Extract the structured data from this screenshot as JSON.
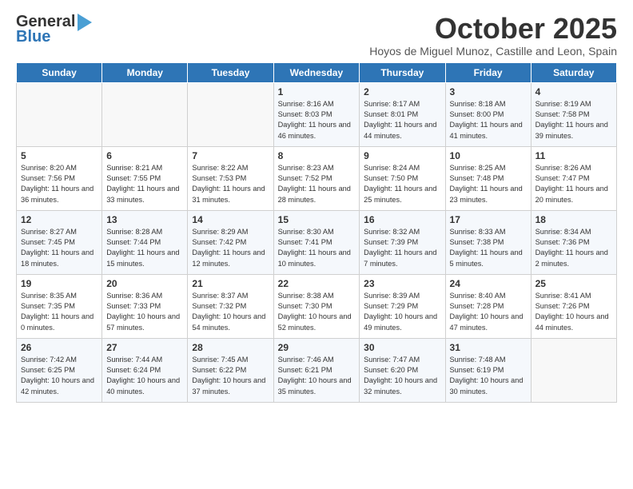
{
  "header": {
    "logo_general": "General",
    "logo_blue": "Blue",
    "month_title": "October 2025",
    "subtitle": "Hoyos de Miguel Munoz, Castille and Leon, Spain"
  },
  "weekdays": [
    "Sunday",
    "Monday",
    "Tuesday",
    "Wednesday",
    "Thursday",
    "Friday",
    "Saturday"
  ],
  "weeks": [
    [
      {
        "day": "",
        "sunrise": "",
        "sunset": "",
        "daylight": ""
      },
      {
        "day": "",
        "sunrise": "",
        "sunset": "",
        "daylight": ""
      },
      {
        "day": "",
        "sunrise": "",
        "sunset": "",
        "daylight": ""
      },
      {
        "day": "1",
        "sunrise": "Sunrise: 8:16 AM",
        "sunset": "Sunset: 8:03 PM",
        "daylight": "Daylight: 11 hours and 46 minutes."
      },
      {
        "day": "2",
        "sunrise": "Sunrise: 8:17 AM",
        "sunset": "Sunset: 8:01 PM",
        "daylight": "Daylight: 11 hours and 44 minutes."
      },
      {
        "day": "3",
        "sunrise": "Sunrise: 8:18 AM",
        "sunset": "Sunset: 8:00 PM",
        "daylight": "Daylight: 11 hours and 41 minutes."
      },
      {
        "day": "4",
        "sunrise": "Sunrise: 8:19 AM",
        "sunset": "Sunset: 7:58 PM",
        "daylight": "Daylight: 11 hours and 39 minutes."
      }
    ],
    [
      {
        "day": "5",
        "sunrise": "Sunrise: 8:20 AM",
        "sunset": "Sunset: 7:56 PM",
        "daylight": "Daylight: 11 hours and 36 minutes."
      },
      {
        "day": "6",
        "sunrise": "Sunrise: 8:21 AM",
        "sunset": "Sunset: 7:55 PM",
        "daylight": "Daylight: 11 hours and 33 minutes."
      },
      {
        "day": "7",
        "sunrise": "Sunrise: 8:22 AM",
        "sunset": "Sunset: 7:53 PM",
        "daylight": "Daylight: 11 hours and 31 minutes."
      },
      {
        "day": "8",
        "sunrise": "Sunrise: 8:23 AM",
        "sunset": "Sunset: 7:52 PM",
        "daylight": "Daylight: 11 hours and 28 minutes."
      },
      {
        "day": "9",
        "sunrise": "Sunrise: 8:24 AM",
        "sunset": "Sunset: 7:50 PM",
        "daylight": "Daylight: 11 hours and 25 minutes."
      },
      {
        "day": "10",
        "sunrise": "Sunrise: 8:25 AM",
        "sunset": "Sunset: 7:48 PM",
        "daylight": "Daylight: 11 hours and 23 minutes."
      },
      {
        "day": "11",
        "sunrise": "Sunrise: 8:26 AM",
        "sunset": "Sunset: 7:47 PM",
        "daylight": "Daylight: 11 hours and 20 minutes."
      }
    ],
    [
      {
        "day": "12",
        "sunrise": "Sunrise: 8:27 AM",
        "sunset": "Sunset: 7:45 PM",
        "daylight": "Daylight: 11 hours and 18 minutes."
      },
      {
        "day": "13",
        "sunrise": "Sunrise: 8:28 AM",
        "sunset": "Sunset: 7:44 PM",
        "daylight": "Daylight: 11 hours and 15 minutes."
      },
      {
        "day": "14",
        "sunrise": "Sunrise: 8:29 AM",
        "sunset": "Sunset: 7:42 PM",
        "daylight": "Daylight: 11 hours and 12 minutes."
      },
      {
        "day": "15",
        "sunrise": "Sunrise: 8:30 AM",
        "sunset": "Sunset: 7:41 PM",
        "daylight": "Daylight: 11 hours and 10 minutes."
      },
      {
        "day": "16",
        "sunrise": "Sunrise: 8:32 AM",
        "sunset": "Sunset: 7:39 PM",
        "daylight": "Daylight: 11 hours and 7 minutes."
      },
      {
        "day": "17",
        "sunrise": "Sunrise: 8:33 AM",
        "sunset": "Sunset: 7:38 PM",
        "daylight": "Daylight: 11 hours and 5 minutes."
      },
      {
        "day": "18",
        "sunrise": "Sunrise: 8:34 AM",
        "sunset": "Sunset: 7:36 PM",
        "daylight": "Daylight: 11 hours and 2 minutes."
      }
    ],
    [
      {
        "day": "19",
        "sunrise": "Sunrise: 8:35 AM",
        "sunset": "Sunset: 7:35 PM",
        "daylight": "Daylight: 11 hours and 0 minutes."
      },
      {
        "day": "20",
        "sunrise": "Sunrise: 8:36 AM",
        "sunset": "Sunset: 7:33 PM",
        "daylight": "Daylight: 10 hours and 57 minutes."
      },
      {
        "day": "21",
        "sunrise": "Sunrise: 8:37 AM",
        "sunset": "Sunset: 7:32 PM",
        "daylight": "Daylight: 10 hours and 54 minutes."
      },
      {
        "day": "22",
        "sunrise": "Sunrise: 8:38 AM",
        "sunset": "Sunset: 7:30 PM",
        "daylight": "Daylight: 10 hours and 52 minutes."
      },
      {
        "day": "23",
        "sunrise": "Sunrise: 8:39 AM",
        "sunset": "Sunset: 7:29 PM",
        "daylight": "Daylight: 10 hours and 49 minutes."
      },
      {
        "day": "24",
        "sunrise": "Sunrise: 8:40 AM",
        "sunset": "Sunset: 7:28 PM",
        "daylight": "Daylight: 10 hours and 47 minutes."
      },
      {
        "day": "25",
        "sunrise": "Sunrise: 8:41 AM",
        "sunset": "Sunset: 7:26 PM",
        "daylight": "Daylight: 10 hours and 44 minutes."
      }
    ],
    [
      {
        "day": "26",
        "sunrise": "Sunrise: 7:42 AM",
        "sunset": "Sunset: 6:25 PM",
        "daylight": "Daylight: 10 hours and 42 minutes."
      },
      {
        "day": "27",
        "sunrise": "Sunrise: 7:44 AM",
        "sunset": "Sunset: 6:24 PM",
        "daylight": "Daylight: 10 hours and 40 minutes."
      },
      {
        "day": "28",
        "sunrise": "Sunrise: 7:45 AM",
        "sunset": "Sunset: 6:22 PM",
        "daylight": "Daylight: 10 hours and 37 minutes."
      },
      {
        "day": "29",
        "sunrise": "Sunrise: 7:46 AM",
        "sunset": "Sunset: 6:21 PM",
        "daylight": "Daylight: 10 hours and 35 minutes."
      },
      {
        "day": "30",
        "sunrise": "Sunrise: 7:47 AM",
        "sunset": "Sunset: 6:20 PM",
        "daylight": "Daylight: 10 hours and 32 minutes."
      },
      {
        "day": "31",
        "sunrise": "Sunrise: 7:48 AM",
        "sunset": "Sunset: 6:19 PM",
        "daylight": "Daylight: 10 hours and 30 minutes."
      },
      {
        "day": "",
        "sunrise": "",
        "sunset": "",
        "daylight": ""
      }
    ]
  ]
}
